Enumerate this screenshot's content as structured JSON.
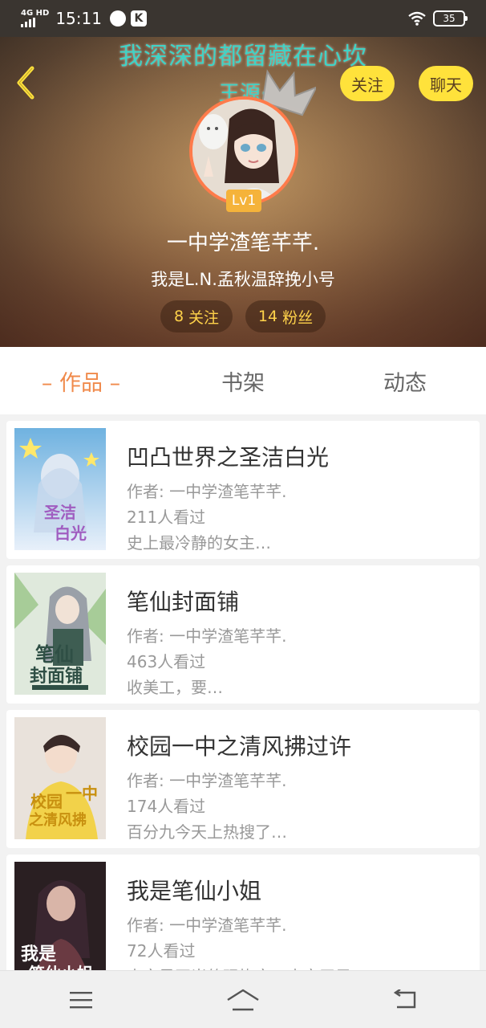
{
  "status_bar": {
    "network": "4G HD",
    "time": "15:11",
    "battery": "35",
    "app_badge": "K"
  },
  "profile": {
    "banner_text": "我深深的都留藏在心坎",
    "banner_sub": "王源·",
    "level": "Lv1",
    "name": "一中学渣笔芊芊.",
    "bio": "我是L.N.孟秋温辞挽小号",
    "following_count": "8",
    "following_label": "关注",
    "fans_count": "14",
    "fans_label": "粉丝",
    "follow_button": "关注",
    "chat_button": "聊天"
  },
  "tabs": [
    {
      "label": "– 作品 –",
      "active": true
    },
    {
      "label": "书架",
      "active": false
    },
    {
      "label": "动态",
      "active": false
    }
  ],
  "books": [
    {
      "title": "凹凸世界之圣洁白光",
      "author": "作者: 一中学渣笔芊芊.",
      "views": "211人看过",
      "desc": "史上最冷静的女主…",
      "cover_text": "圣洁白光"
    },
    {
      "title": "笔仙封面铺",
      "author": "作者: 一中学渣笔芊芊.",
      "views": "463人看过",
      "desc": "收美工，要…",
      "cover_text": "笔仙封面铺"
    },
    {
      "title": "校园一中之清风拂过许",
      "author": "作者: 一中学渣笔芊芊.",
      "views": "174人看过",
      "desc": "百分九今天上热搜了…",
      "cover_text": "校园一中之清风拂"
    },
    {
      "title": "我是笔仙小姐",
      "author": "作者: 一中学渣笔芊芊.",
      "views": "72人看过",
      "desc": "本文是正当的现恢文，本文无男",
      "cover_text": "我是笔仙小姐"
    }
  ],
  "colors": {
    "accent": "#f08a4b",
    "button_yellow": "#ffe23b",
    "banner_teal": "#3fd3c6",
    "stat_text": "#ffd24a"
  },
  "icons": {
    "back": "chevron-left-icon",
    "crown": "crown-icon",
    "menu": "menu-icon",
    "home": "home-icon",
    "return": "back-arrow-icon"
  }
}
